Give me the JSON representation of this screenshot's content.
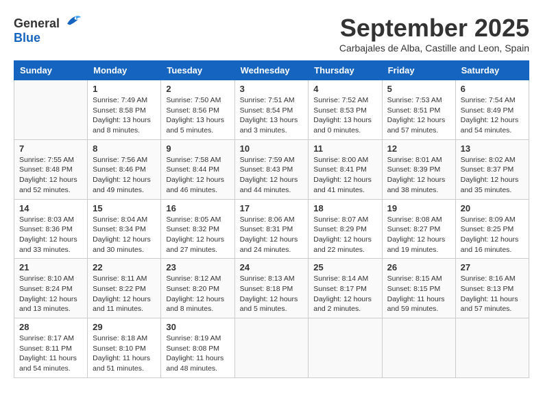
{
  "header": {
    "logo_general": "General",
    "logo_blue": "Blue",
    "month_title": "September 2025",
    "subtitle": "Carbajales de Alba, Castille and Leon, Spain"
  },
  "weekdays": [
    "Sunday",
    "Monday",
    "Tuesday",
    "Wednesday",
    "Thursday",
    "Friday",
    "Saturday"
  ],
  "weeks": [
    [
      {
        "day": "",
        "sunrise": "",
        "sunset": "",
        "daylight": ""
      },
      {
        "day": "1",
        "sunrise": "Sunrise: 7:49 AM",
        "sunset": "Sunset: 8:58 PM",
        "daylight": "Daylight: 13 hours and 8 minutes."
      },
      {
        "day": "2",
        "sunrise": "Sunrise: 7:50 AM",
        "sunset": "Sunset: 8:56 PM",
        "daylight": "Daylight: 13 hours and 5 minutes."
      },
      {
        "day": "3",
        "sunrise": "Sunrise: 7:51 AM",
        "sunset": "Sunset: 8:54 PM",
        "daylight": "Daylight: 13 hours and 3 minutes."
      },
      {
        "day": "4",
        "sunrise": "Sunrise: 7:52 AM",
        "sunset": "Sunset: 8:53 PM",
        "daylight": "Daylight: 13 hours and 0 minutes."
      },
      {
        "day": "5",
        "sunrise": "Sunrise: 7:53 AM",
        "sunset": "Sunset: 8:51 PM",
        "daylight": "Daylight: 12 hours and 57 minutes."
      },
      {
        "day": "6",
        "sunrise": "Sunrise: 7:54 AM",
        "sunset": "Sunset: 8:49 PM",
        "daylight": "Daylight: 12 hours and 54 minutes."
      }
    ],
    [
      {
        "day": "7",
        "sunrise": "Sunrise: 7:55 AM",
        "sunset": "Sunset: 8:48 PM",
        "daylight": "Daylight: 12 hours and 52 minutes."
      },
      {
        "day": "8",
        "sunrise": "Sunrise: 7:56 AM",
        "sunset": "Sunset: 8:46 PM",
        "daylight": "Daylight: 12 hours and 49 minutes."
      },
      {
        "day": "9",
        "sunrise": "Sunrise: 7:58 AM",
        "sunset": "Sunset: 8:44 PM",
        "daylight": "Daylight: 12 hours and 46 minutes."
      },
      {
        "day": "10",
        "sunrise": "Sunrise: 7:59 AM",
        "sunset": "Sunset: 8:43 PM",
        "daylight": "Daylight: 12 hours and 44 minutes."
      },
      {
        "day": "11",
        "sunrise": "Sunrise: 8:00 AM",
        "sunset": "Sunset: 8:41 PM",
        "daylight": "Daylight: 12 hours and 41 minutes."
      },
      {
        "day": "12",
        "sunrise": "Sunrise: 8:01 AM",
        "sunset": "Sunset: 8:39 PM",
        "daylight": "Daylight: 12 hours and 38 minutes."
      },
      {
        "day": "13",
        "sunrise": "Sunrise: 8:02 AM",
        "sunset": "Sunset: 8:37 PM",
        "daylight": "Daylight: 12 hours and 35 minutes."
      }
    ],
    [
      {
        "day": "14",
        "sunrise": "Sunrise: 8:03 AM",
        "sunset": "Sunset: 8:36 PM",
        "daylight": "Daylight: 12 hours and 33 minutes."
      },
      {
        "day": "15",
        "sunrise": "Sunrise: 8:04 AM",
        "sunset": "Sunset: 8:34 PM",
        "daylight": "Daylight: 12 hours and 30 minutes."
      },
      {
        "day": "16",
        "sunrise": "Sunrise: 8:05 AM",
        "sunset": "Sunset: 8:32 PM",
        "daylight": "Daylight: 12 hours and 27 minutes."
      },
      {
        "day": "17",
        "sunrise": "Sunrise: 8:06 AM",
        "sunset": "Sunset: 8:31 PM",
        "daylight": "Daylight: 12 hours and 24 minutes."
      },
      {
        "day": "18",
        "sunrise": "Sunrise: 8:07 AM",
        "sunset": "Sunset: 8:29 PM",
        "daylight": "Daylight: 12 hours and 22 minutes."
      },
      {
        "day": "19",
        "sunrise": "Sunrise: 8:08 AM",
        "sunset": "Sunset: 8:27 PM",
        "daylight": "Daylight: 12 hours and 19 minutes."
      },
      {
        "day": "20",
        "sunrise": "Sunrise: 8:09 AM",
        "sunset": "Sunset: 8:25 PM",
        "daylight": "Daylight: 12 hours and 16 minutes."
      }
    ],
    [
      {
        "day": "21",
        "sunrise": "Sunrise: 8:10 AM",
        "sunset": "Sunset: 8:24 PM",
        "daylight": "Daylight: 12 hours and 13 minutes."
      },
      {
        "day": "22",
        "sunrise": "Sunrise: 8:11 AM",
        "sunset": "Sunset: 8:22 PM",
        "daylight": "Daylight: 12 hours and 11 minutes."
      },
      {
        "day": "23",
        "sunrise": "Sunrise: 8:12 AM",
        "sunset": "Sunset: 8:20 PM",
        "daylight": "Daylight: 12 hours and 8 minutes."
      },
      {
        "day": "24",
        "sunrise": "Sunrise: 8:13 AM",
        "sunset": "Sunset: 8:18 PM",
        "daylight": "Daylight: 12 hours and 5 minutes."
      },
      {
        "day": "25",
        "sunrise": "Sunrise: 8:14 AM",
        "sunset": "Sunset: 8:17 PM",
        "daylight": "Daylight: 12 hours and 2 minutes."
      },
      {
        "day": "26",
        "sunrise": "Sunrise: 8:15 AM",
        "sunset": "Sunset: 8:15 PM",
        "daylight": "Daylight: 11 hours and 59 minutes."
      },
      {
        "day": "27",
        "sunrise": "Sunrise: 8:16 AM",
        "sunset": "Sunset: 8:13 PM",
        "daylight": "Daylight: 11 hours and 57 minutes."
      }
    ],
    [
      {
        "day": "28",
        "sunrise": "Sunrise: 8:17 AM",
        "sunset": "Sunset: 8:11 PM",
        "daylight": "Daylight: 11 hours and 54 minutes."
      },
      {
        "day": "29",
        "sunrise": "Sunrise: 8:18 AM",
        "sunset": "Sunset: 8:10 PM",
        "daylight": "Daylight: 11 hours and 51 minutes."
      },
      {
        "day": "30",
        "sunrise": "Sunrise: 8:19 AM",
        "sunset": "Sunset: 8:08 PM",
        "daylight": "Daylight: 11 hours and 48 minutes."
      },
      {
        "day": "",
        "sunrise": "",
        "sunset": "",
        "daylight": ""
      },
      {
        "day": "",
        "sunrise": "",
        "sunset": "",
        "daylight": ""
      },
      {
        "day": "",
        "sunrise": "",
        "sunset": "",
        "daylight": ""
      },
      {
        "day": "",
        "sunrise": "",
        "sunset": "",
        "daylight": ""
      }
    ]
  ]
}
